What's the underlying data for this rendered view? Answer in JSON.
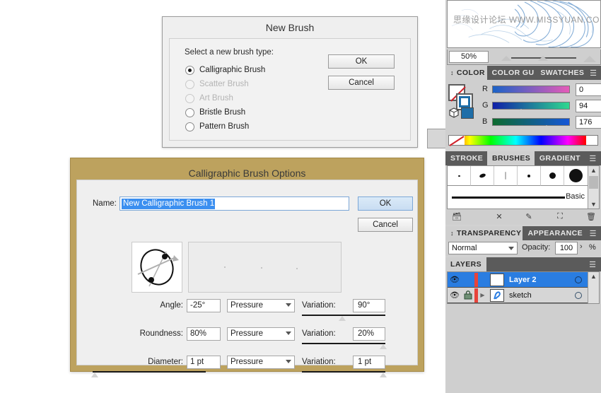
{
  "new_brush_dialog": {
    "title": "New Brush",
    "prompt": "Select a new brush type:",
    "options": [
      {
        "label": "Calligraphic Brush",
        "checked": true,
        "disabled": false
      },
      {
        "label": "Scatter Brush",
        "checked": false,
        "disabled": true
      },
      {
        "label": "Art Brush",
        "checked": false,
        "disabled": true
      },
      {
        "label": "Bristle Brush",
        "checked": false,
        "disabled": false
      },
      {
        "label": "Pattern Brush",
        "checked": false,
        "disabled": false
      }
    ],
    "ok_label": "OK",
    "cancel_label": "Cancel"
  },
  "calligraphic_dialog": {
    "title": "Calligraphic Brush Options",
    "title_bar_color": "#bda25e",
    "name_label": "Name:",
    "name_value": "New Calligraphic Brush 1",
    "ok_label": "OK",
    "cancel_label": "Cancel",
    "params": [
      {
        "label": "Angle:",
        "value": "-25°",
        "source": "Pressure",
        "variation_label": "Variation:",
        "variation_value": "90°",
        "variation_thumb_pct": 47,
        "left_thumb_pct": null
      },
      {
        "label": "Roundness:",
        "value": "80%",
        "source": "Pressure",
        "variation_label": "Variation:",
        "variation_value": "20%",
        "variation_thumb_pct": 96,
        "left_thumb_pct": null
      },
      {
        "label": "Diameter:",
        "value": "1 pt",
        "source": "Pressure",
        "variation_label": "Variation:",
        "variation_value": "1 pt",
        "variation_thumb_pct": 96,
        "left_thumb_pct": 2
      }
    ]
  },
  "canvas": {
    "watermark": "思缘设计论坛 WWW.MISSYUAN.COM",
    "zoom_level": "50%"
  },
  "color_panel": {
    "tabs": [
      {
        "label": "COLOR",
        "active": true
      },
      {
        "label": "COLOR GU",
        "active": false
      },
      {
        "label": "SWATCHES",
        "active": false
      }
    ],
    "menu_icon": "panel-menu-icon",
    "fill": "none",
    "stroke_color": "#005eb0",
    "channels": [
      {
        "name": "R",
        "value": "0",
        "thumb_pct": 0
      },
      {
        "name": "G",
        "value": "94",
        "thumb_pct": 37
      },
      {
        "name": "B",
        "value": "176",
        "thumb_pct": 69
      }
    ]
  },
  "brushes_panel": {
    "tabs": [
      {
        "label": "STROKE",
        "active": false
      },
      {
        "label": "BRUSHES",
        "active": true
      },
      {
        "label": "GRADIENT",
        "active": false
      }
    ],
    "brush_sizes": [
      2,
      5,
      3,
      4,
      10,
      20
    ],
    "basic_brush_label": "Basic",
    "footer_icons": [
      "brush-libraries-icon",
      "remove-brush-stroke-icon",
      "options-of-selected-object-icon",
      "new-brush-icon",
      "delete-brush-icon"
    ]
  },
  "transparency_panel": {
    "tabs": [
      {
        "label": "TRANSPARENCY",
        "active": true
      },
      {
        "label": "APPEARANCE",
        "active": false
      }
    ],
    "blend_mode": "Normal",
    "opacity_label": "Opacity:",
    "opacity_value": "100",
    "percent_symbol": "%"
  },
  "layers_panel": {
    "tabs": [
      {
        "label": "LAYERS",
        "active": true
      }
    ],
    "rows": [
      {
        "name": "Layer 2",
        "selected": true,
        "locked": false,
        "visible": true,
        "has_children": false
      },
      {
        "name": "sketch",
        "selected": false,
        "locked": true,
        "visible": true,
        "has_children": true
      }
    ]
  }
}
